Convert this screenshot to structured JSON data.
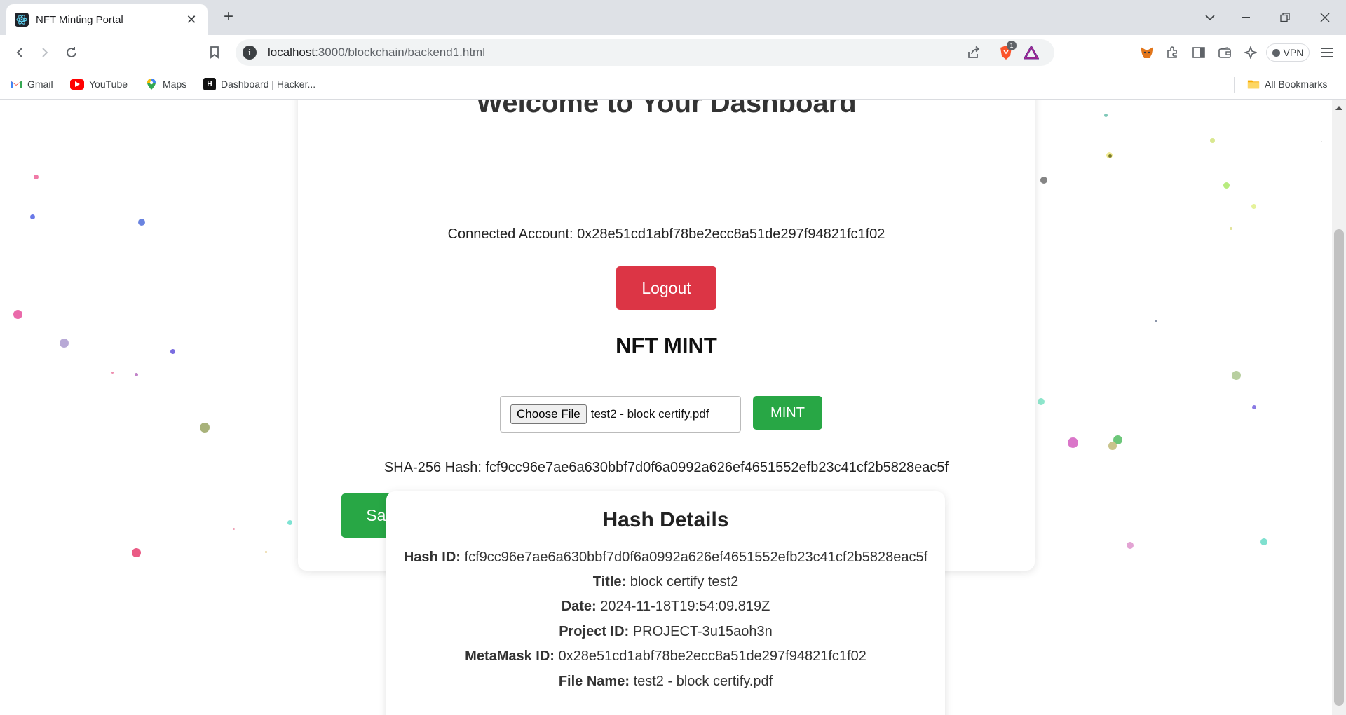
{
  "browser": {
    "tab_title": "NFT Minting Portal",
    "url_host": "localhost",
    "url_path": ":3000/blockchain/backend1.html",
    "brave_badge": "1",
    "vpn_label": "VPN",
    "bookmarks": [
      {
        "label": "Gmail",
        "icon": "gmail-icon"
      },
      {
        "label": "YouTube",
        "icon": "youtube-icon"
      },
      {
        "label": "Maps",
        "icon": "maps-icon"
      },
      {
        "label": "Dashboard | Hacker...",
        "icon": "hackerrank-icon"
      }
    ],
    "all_bookmarks": "All Bookmarks"
  },
  "dashboard": {
    "heading": "Welcome to Your Dashboard",
    "connected_label": "Connected Account:",
    "connected_account": "0x28e51cd1abf78be2ecc8a51de297f94821fc1f02",
    "logout_label": "Logout",
    "nft_title": "NFT MINT",
    "choose_file_label": "Choose File",
    "selected_file": "test2 - block certify.pdf",
    "mint_label": "MINT",
    "sha_label": "SHA-256 Hash:",
    "sha_value": "fcf9cc96e7ae6a630bbf7d0f6a0992a626ef4651552efb23c41cf2b5828eac5f",
    "save_label": "Save in Blockchain"
  },
  "hash_details": {
    "title": "Hash Details",
    "rows": [
      {
        "label": "Hash ID:",
        "value": "fcf9cc96e7ae6a630bbf7d0f6a0992a626ef4651552efb23c41cf2b5828eac5f"
      },
      {
        "label": "Title:",
        "value": "block certify test2"
      },
      {
        "label": "Date:",
        "value": "2024-11-18T19:54:09.819Z"
      },
      {
        "label": "Project ID:",
        "value": "PROJECT-3u15aoh3n"
      },
      {
        "label": "MetaMask ID:",
        "value": "0x28e51cd1abf78be2ecc8a51de297f94821fc1f02"
      },
      {
        "label": "File Name:",
        "value": "test2 - block certify.pdf"
      }
    ]
  },
  "colors": {
    "logout": "#dc3545",
    "mint": "#28a745",
    "save": "#28a745"
  }
}
